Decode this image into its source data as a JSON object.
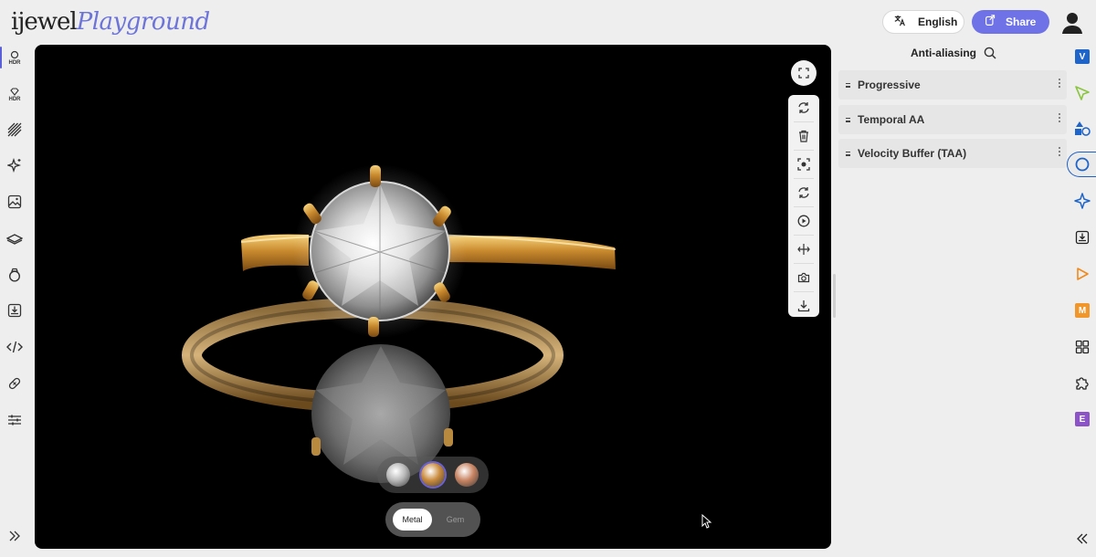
{
  "header": {
    "logo_part1": "ijewel",
    "logo_part2": "Playground",
    "language": "English",
    "share": "Share"
  },
  "left_rail": {
    "items": [
      {
        "icon": "hdr-environment-icon",
        "label": "HDR",
        "active": true
      },
      {
        "icon": "hdr-diamond-icon",
        "label": "HDR"
      },
      {
        "icon": "hatch-pattern-icon"
      },
      {
        "icon": "sparkle-effects-icon"
      },
      {
        "icon": "image-frame-icon"
      },
      {
        "icon": "ground-plane-icon"
      },
      {
        "icon": "ring-icon"
      },
      {
        "icon": "import-icon"
      },
      {
        "icon": "code-icon"
      },
      {
        "icon": "bandage-icon"
      },
      {
        "icon": "sliders-icon"
      },
      {
        "icon": "expand-double-chevron-icon"
      }
    ]
  },
  "viewport": {
    "swatches": [
      {
        "name": "silver",
        "color": "#b8b8b8"
      },
      {
        "name": "gold",
        "color": "#c98a3c",
        "selected": true
      },
      {
        "name": "rose-gold",
        "color": "#c88462"
      }
    ],
    "segments": {
      "metal": "Metal",
      "gem": "Gem"
    }
  },
  "panel": {
    "title": "Anti-aliasing",
    "rows": [
      "Progressive",
      "Temporal AA",
      "Velocity Buffer (TAA)"
    ]
  },
  "right_rail": {
    "items": [
      {
        "icon": "badge-v-icon",
        "letter": "V",
        "color": "#1f64c8"
      },
      {
        "icon": "pointer-select-icon",
        "color": "#8ac540"
      },
      {
        "icon": "shapes-icon",
        "color": "#1f64c8"
      },
      {
        "icon": "anti-aliasing-icon",
        "color": "#1f64c8",
        "active": true
      },
      {
        "icon": "sparkle-icon",
        "color": "#1f64c8"
      },
      {
        "icon": "export-icon",
        "color": "#222"
      },
      {
        "icon": "play-icon",
        "color": "#f08a1c"
      },
      {
        "icon": "badge-m-icon",
        "letter": "M",
        "color": "#f0962a"
      },
      {
        "icon": "grid-icon",
        "color": "#222"
      },
      {
        "icon": "puzzle-icon",
        "color": "#222"
      },
      {
        "icon": "badge-e-icon",
        "letter": "E",
        "color": "#8c52c8"
      },
      {
        "icon": "collapse-double-chevron-icon",
        "color": "#222"
      }
    ]
  }
}
